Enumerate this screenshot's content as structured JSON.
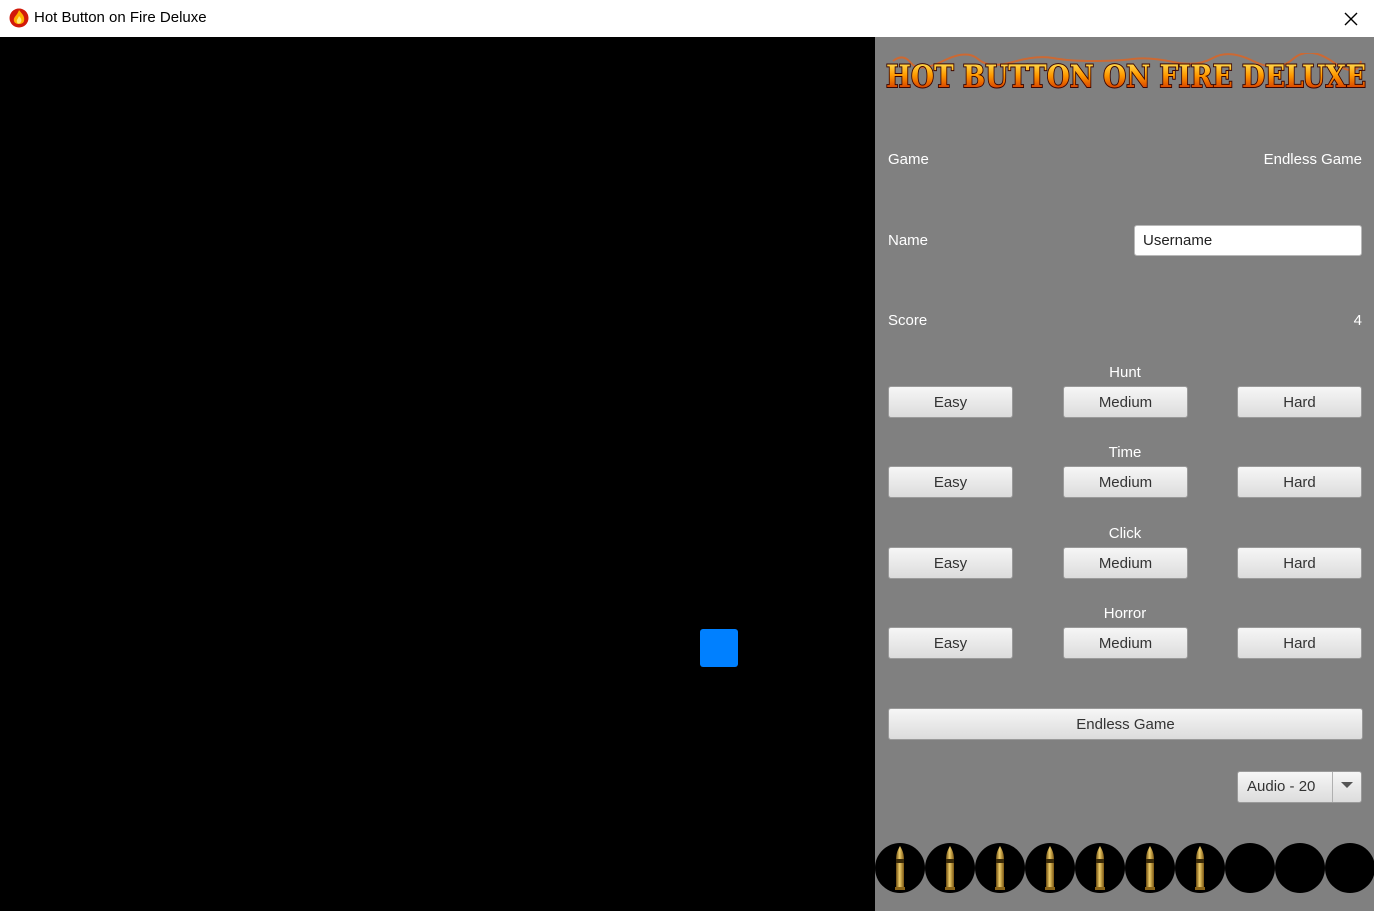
{
  "window": {
    "title": "Hot Button on Fire Deluxe",
    "app_icon": "flame-icon",
    "close_icon": "close-icon"
  },
  "game_area": {
    "target_color": "#0080ff",
    "background": "#000000"
  },
  "panel": {
    "logo_text": "HOT BUTTON ON FIRE DELUXE",
    "game_label": "Game",
    "game_value": "Endless Game",
    "name_label": "Name",
    "name_value": "Username",
    "score_label": "Score",
    "score_value": "4",
    "modes": [
      {
        "title": "Hunt",
        "easy": "Easy",
        "medium": "Medium",
        "hard": "Hard"
      },
      {
        "title": "Time",
        "easy": "Easy",
        "medium": "Medium",
        "hard": "Hard"
      },
      {
        "title": "Click",
        "easy": "Easy",
        "medium": "Medium",
        "hard": "Hard"
      },
      {
        "title": "Horror",
        "easy": "Easy",
        "medium": "Medium",
        "hard": "Hard"
      }
    ],
    "endless_button": "Endless Game",
    "audio_select": "Audio - 20",
    "ammo": {
      "loaded": 7,
      "total": 10,
      "icon": "bullet-icon"
    }
  }
}
